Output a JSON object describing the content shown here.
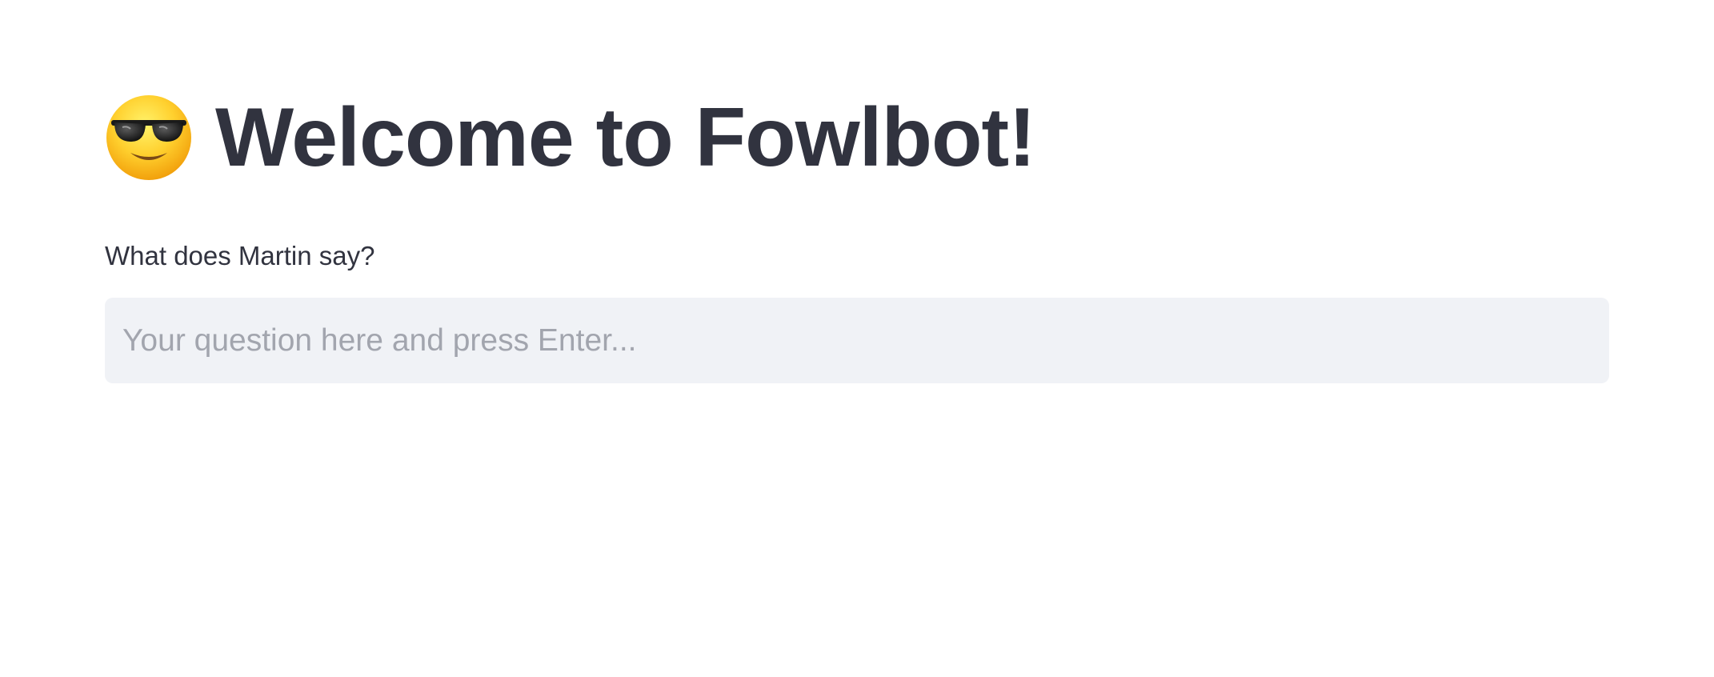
{
  "header": {
    "emoji": "smiling-face-with-sunglasses",
    "title": "Welcome to Fowlbot!"
  },
  "question": {
    "label": "What does Martin say?",
    "value": "",
    "placeholder": "Your question here and press Enter..."
  },
  "colors": {
    "text": "#31333f",
    "input_background": "#f0f2f6",
    "placeholder": "#a2a5ae",
    "page_background": "#ffffff"
  }
}
